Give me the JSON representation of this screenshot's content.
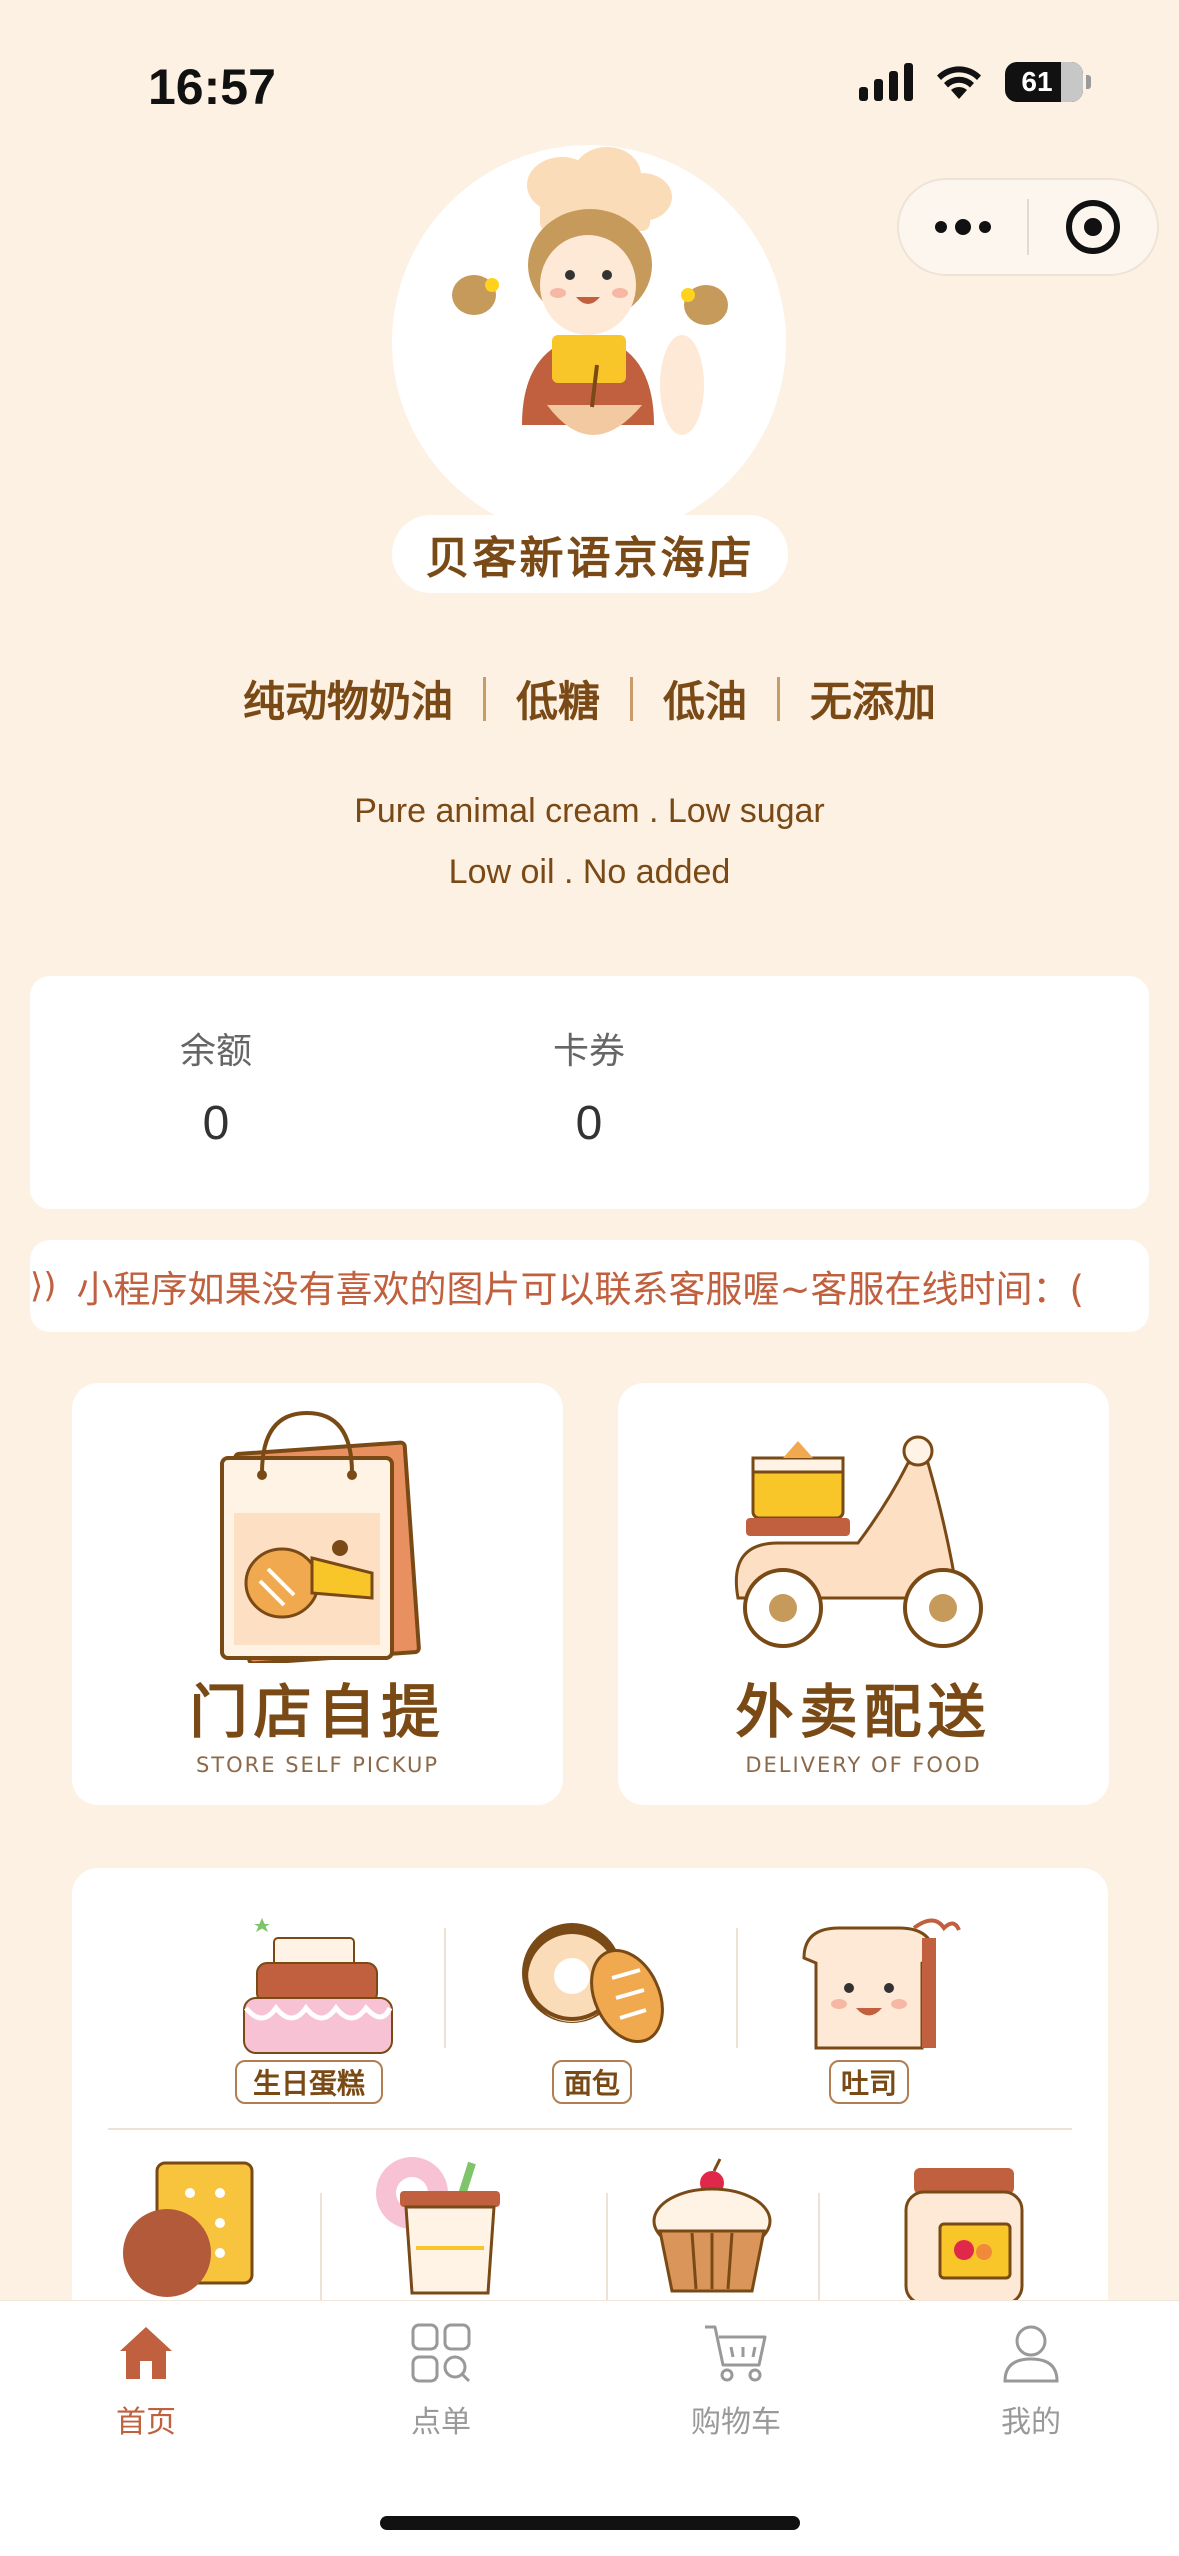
{
  "status_bar": {
    "time": "16:57",
    "battery": "61"
  },
  "shop": {
    "name": "贝客新语京海店"
  },
  "tags": [
    "纯动物奶油",
    "低糖",
    "低油",
    "无添加"
  ],
  "slogan": {
    "line1": "Pure animal cream . Low sugar",
    "line2": "Low oil . No added"
  },
  "balance": {
    "balance_label": "余额",
    "balance_value": "0",
    "coupon_label": "卡券",
    "coupon_value": "0"
  },
  "notice": {
    "text": "小程序如果没有喜欢的图片可以联系客服喔~客服在线时间：("
  },
  "services": {
    "pickup_title": "门店自提",
    "pickup_sub": "STORE SELF PICKUP",
    "delivery_title": "外卖配送",
    "delivery_sub": "DELIVERY OF FOOD"
  },
  "categories": {
    "row1": [
      "生日蛋糕",
      "面包",
      "吐司"
    ]
  },
  "tabbar": {
    "home": "首页",
    "order": "点单",
    "cart": "购物车",
    "mine": "我的"
  },
  "colors": {
    "background": "#fdf1e4",
    "brand_brown": "#7a4a16",
    "accent": "#c0603e"
  }
}
